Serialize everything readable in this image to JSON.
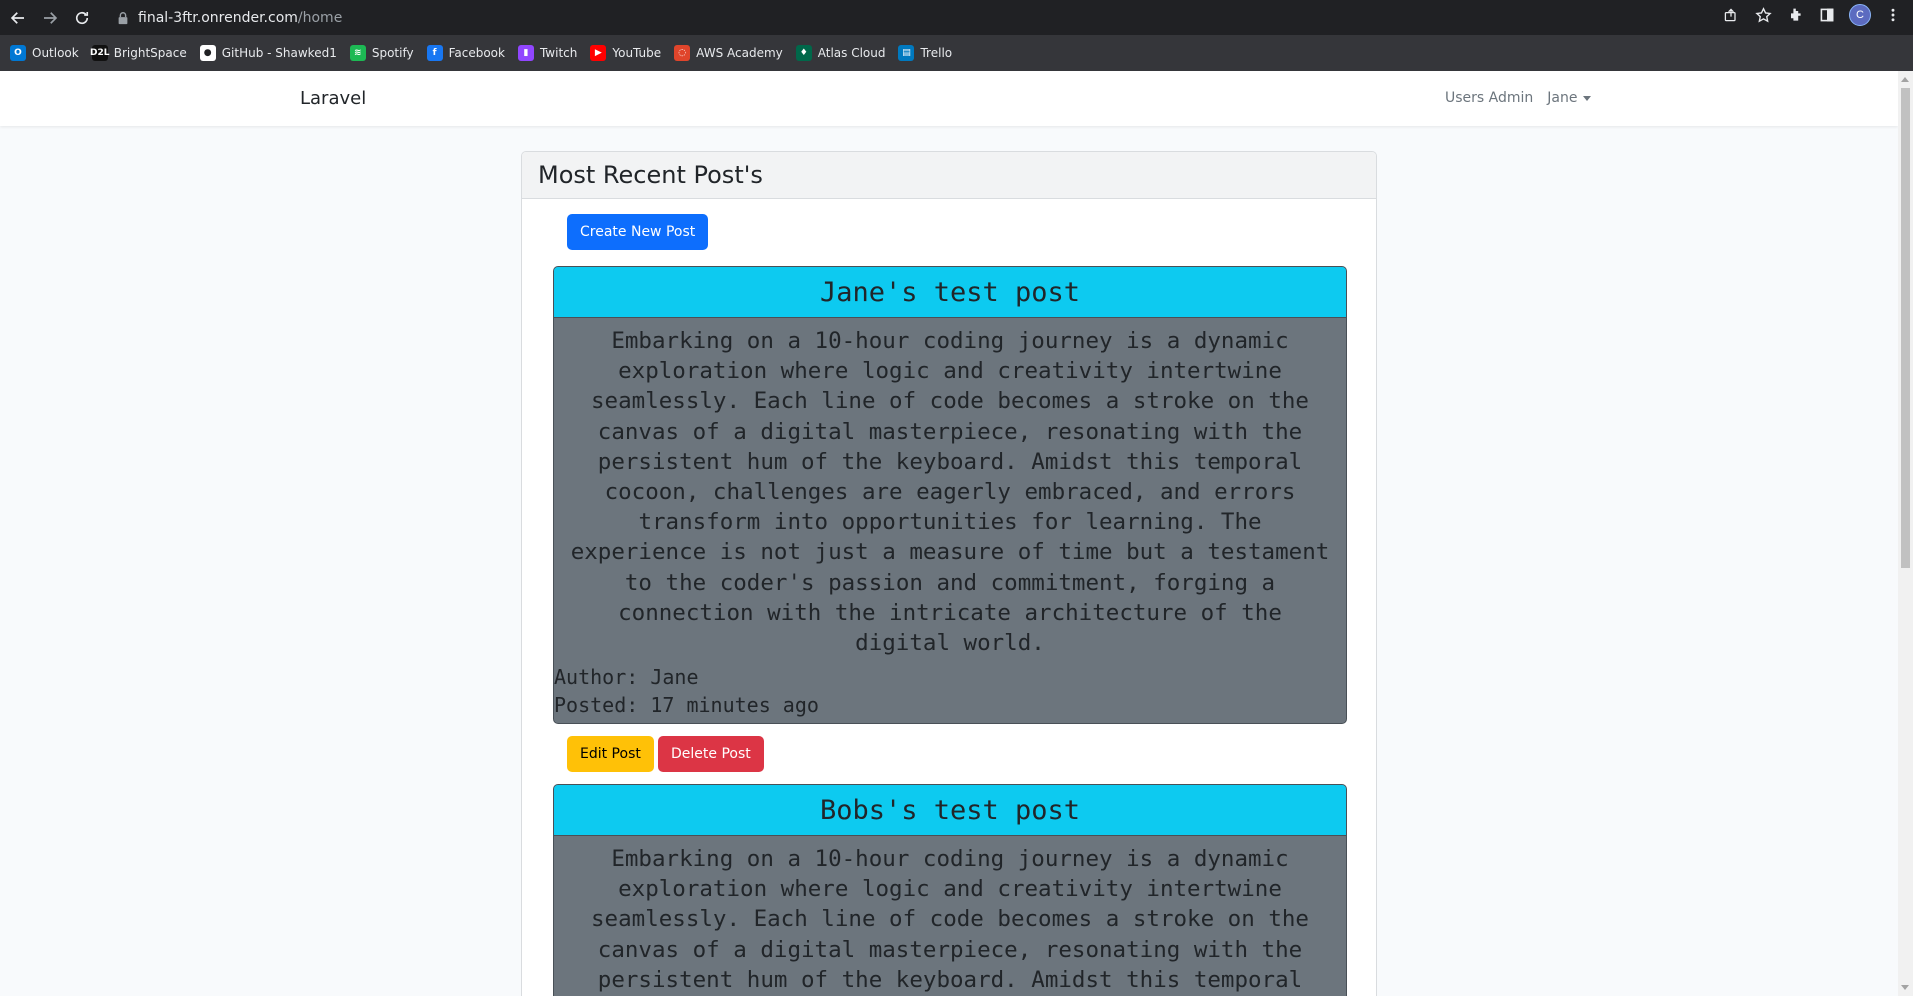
{
  "browser": {
    "url_host": "final-3ftr.onrender.com",
    "url_path": "/home",
    "profile_initial": "C",
    "bookmarks": [
      {
        "label": "Outlook",
        "icon": "outlook-icon",
        "color": "#0078d4",
        "glyph": "O"
      },
      {
        "label": "BrightSpace",
        "icon": "brightspace-icon",
        "color": "#111111",
        "glyph": "D2L"
      },
      {
        "label": "GitHub - Shawked1",
        "icon": "github-icon",
        "color": "#ffffff",
        "glyph": "●"
      },
      {
        "label": "Spotify",
        "icon": "spotify-icon",
        "color": "#1db954",
        "glyph": "≋"
      },
      {
        "label": "Facebook",
        "icon": "facebook-icon",
        "color": "#1877f2",
        "glyph": "f"
      },
      {
        "label": "Twitch",
        "icon": "twitch-icon",
        "color": "#9146ff",
        "glyph": "▮"
      },
      {
        "label": "YouTube",
        "icon": "youtube-icon",
        "color": "#ff0000",
        "glyph": "▶"
      },
      {
        "label": "AWS Academy",
        "icon": "aws-academy-icon",
        "color": "#e0452b",
        "glyph": "◌"
      },
      {
        "label": "Atlas Cloud",
        "icon": "atlas-cloud-icon",
        "color": "#00684a",
        "glyph": "♦"
      },
      {
        "label": "Trello",
        "icon": "trello-icon",
        "color": "#0079bf",
        "glyph": "▤"
      }
    ]
  },
  "navbar": {
    "brand": "Laravel",
    "users_admin": "Users Admin",
    "user_menu": "Jane"
  },
  "main": {
    "header": "Most Recent Post's",
    "create_button": "Create New Post",
    "edit_button": "Edit Post",
    "delete_button": "Delete Post",
    "posts": [
      {
        "title": "Jane's test post",
        "body": "Embarking on a 10-hour coding journey is a dynamic exploration where logic and creativity intertwine seamlessly. Each line of code becomes a stroke on the canvas of a digital masterpiece, resonating with the persistent hum of the keyboard. Amidst this temporal cocoon, challenges are eagerly embraced, and errors transform into opportunities for learning. The experience is not just a measure of time but a testament to the coder's passion and commitment, forging a connection with the intricate architecture of the digital world.",
        "author": "Author: Jane",
        "posted": "Posted: 17 minutes ago"
      },
      {
        "title": "Bobs's test post",
        "body": "Embarking on a 10-hour coding journey is a dynamic exploration where logic and creativity intertwine seamlessly. Each line of code becomes a stroke on the canvas of a digital masterpiece, resonating with the persistent hum of the keyboard. Amidst this temporal"
      }
    ]
  }
}
